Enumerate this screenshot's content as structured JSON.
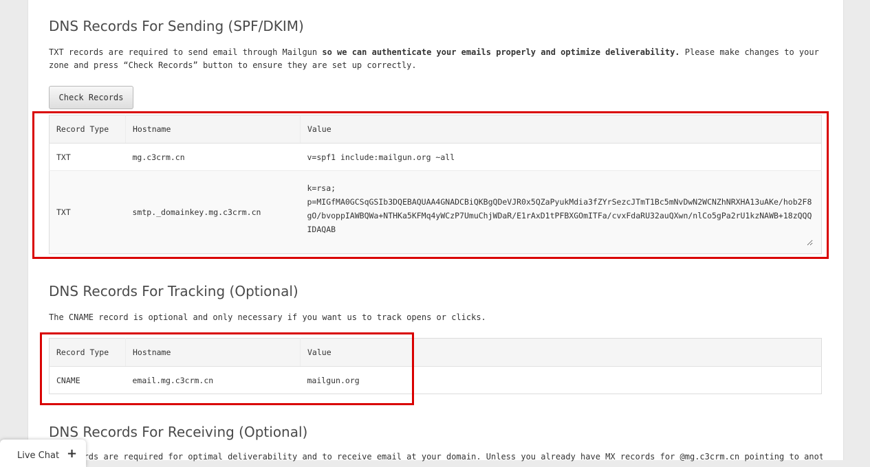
{
  "sending": {
    "heading": "DNS Records For Sending (SPF/DKIM)",
    "intro_pre": "TXT records are required to send email through Mailgun ",
    "intro_bold": "so we can authenticate your emails properly and optimize deliverability.",
    "intro_post": " Please make changes to your zone and press “Check Records” button to ensure they are set up correctly.",
    "check_button": "Check Records",
    "columns": [
      "Record Type",
      "Hostname",
      "Value"
    ],
    "rows": [
      {
        "type": "TXT",
        "hostname": "mg.c3crm.cn",
        "value": "v=spf1 include:mailgun.org ~all"
      },
      {
        "type": "TXT",
        "hostname": "smtp._domainkey.mg.c3crm.cn",
        "value": "k=rsa;\np=MIGfMA0GCSqGSIb3DQEBAQUAA4GNADCBiQKBgQDeVJR0x5QZaPyukMdia3fZYrSezcJTmT1Bc5mNvDwN2WCNZhNRXHA13uAKe/hob2F8gO/bvoppIAWBQWa+NTHKa5KFMq4yWCzP7UmuChjWDaR/E1rAxD1tPFBXGOmITFa/cvxFdaRU32auQXwn/nlCo5gPa2rU1kzNAWB+18zQQQIDAQAB"
      }
    ]
  },
  "tracking": {
    "heading": "DNS Records For Tracking (Optional)",
    "intro": "The CNAME record is optional and only necessary if you want us to track opens or clicks.",
    "columns": [
      "Record Type",
      "Hostname",
      "Value"
    ],
    "rows": [
      {
        "type": "CNAME",
        "hostname": "email.mg.c3crm.cn",
        "value": "mailgun.org"
      }
    ]
  },
  "receiving": {
    "heading": "DNS Records For Receiving (Optional)",
    "intro": "MX records are required for optimal deliverability and to receive email at your domain. Unless you already have MX records for @mg.c3crm.cn pointing to another"
  },
  "livechat": {
    "label": "Live Chat",
    "icon": "plus-icon",
    "plus": "+"
  },
  "colors": {
    "highlight": "#d90000"
  }
}
